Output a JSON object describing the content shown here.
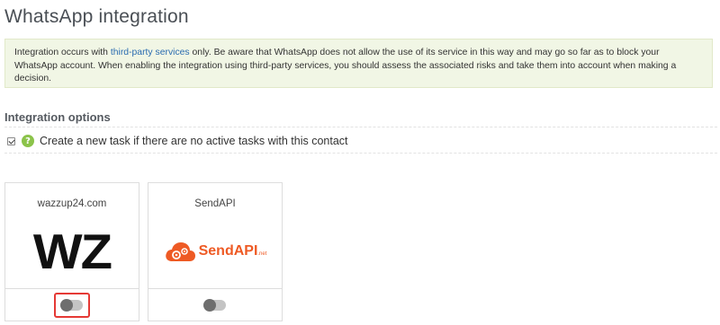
{
  "page": {
    "title": "WhatsApp integration"
  },
  "notice": {
    "text_before": "Integration occurs with ",
    "link": "third-party services",
    "text_after": " only. Be aware that WhatsApp does not allow the use of its service in this way and may go so far as to block your WhatsApp account. When enabling the integration using third-party services, you should assess the associated risks and take them into account when making a decision."
  },
  "options": {
    "title": "Integration options",
    "create_task": {
      "label": "Create a new task if there are no active tasks with this contact",
      "checked": true,
      "help_icon": "help-icon"
    }
  },
  "providers": [
    {
      "name": "wazzup24.com",
      "logo_text": "WZ",
      "enabled": false,
      "highlighted": true
    },
    {
      "name": "SendAPI",
      "logo_text": "SendAPI",
      "logo_suffix": ".net",
      "enabled": false,
      "highlighted": false
    }
  ],
  "colors": {
    "notice_bg": "#f1f6e5",
    "link": "#2b6cb0",
    "help_icon": "#8bc34a",
    "highlight": "#e53935",
    "sendapi_brand": "#ee5a24"
  }
}
